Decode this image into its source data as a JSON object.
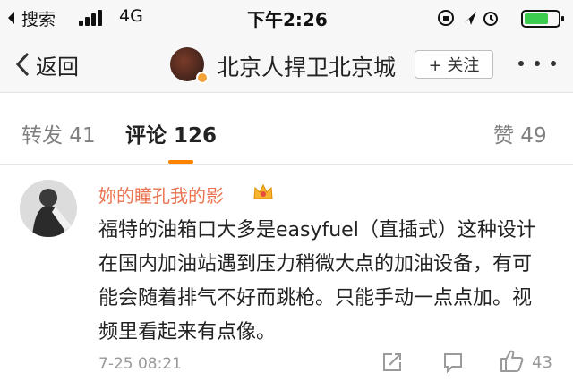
{
  "status_bar": {
    "carrier": "搜索",
    "network": "4G",
    "time": "下午2:26"
  },
  "nav": {
    "back_label": "返回",
    "title": "北京人捍卫北京城",
    "follow_label": "+ 关注"
  },
  "tabs": [
    {
      "label": "转发 41"
    },
    {
      "label": "评论 126"
    },
    {
      "label": "赞 49"
    }
  ],
  "comment": {
    "author": "妳的瞳孔我的影",
    "text": "福特的油箱口大多是easyfuel（直插式）这种设计在国内加油站遇到压力稍微大点的加油设备，有可能会随着排气不好而跳枪。只能手动一点点加。视频里看起来有点像。",
    "time": "7-25 08:21",
    "like_count": "43"
  },
  "colors": {
    "accent": "#ff8200",
    "author_name": "#eb7350",
    "muted_text": "#999999",
    "bar_background": "#f7f7f7"
  }
}
